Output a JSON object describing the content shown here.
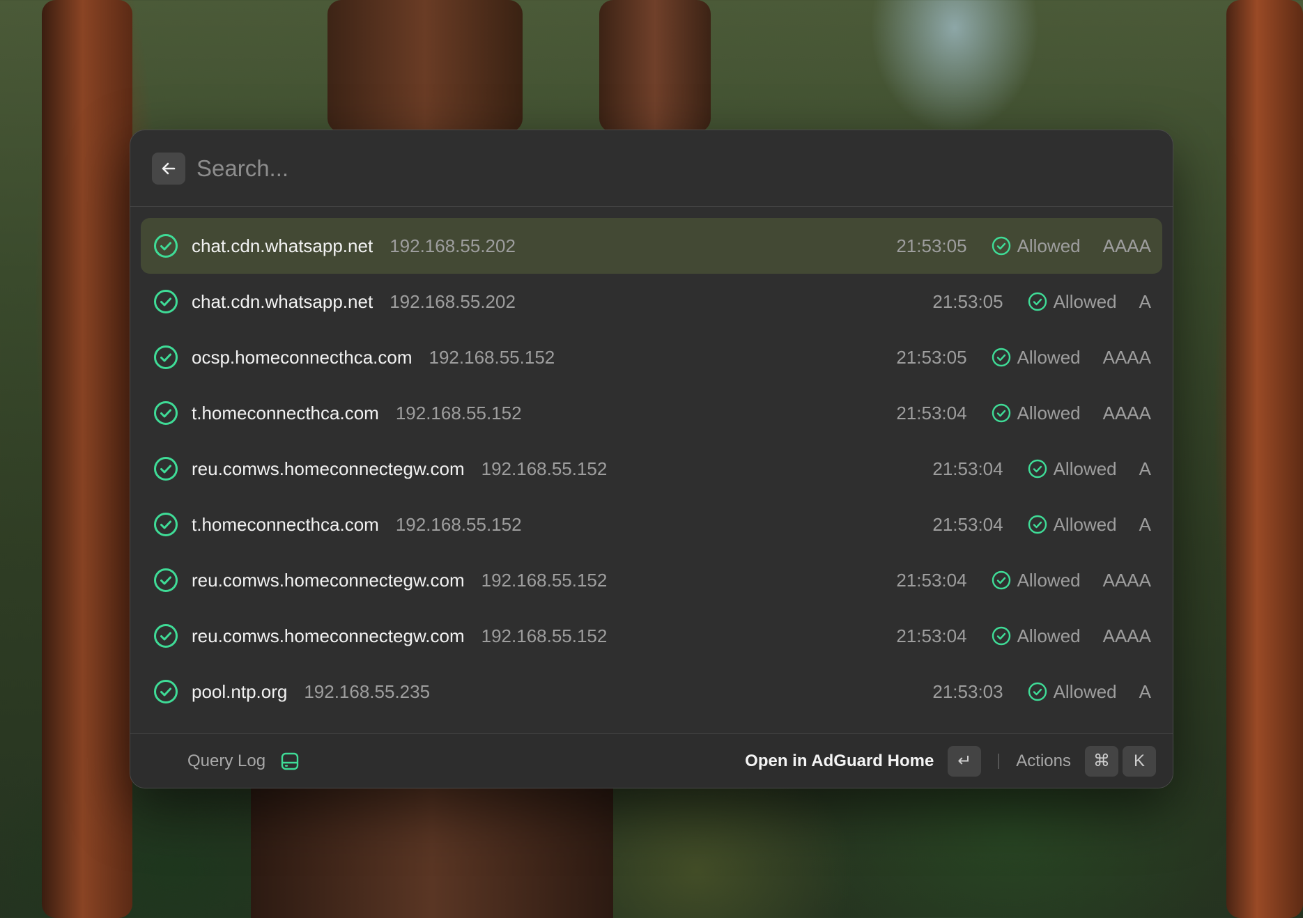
{
  "search": {
    "placeholder": "Search..."
  },
  "rows": [
    {
      "domain": "chat.cdn.whatsapp.net",
      "ip": "192.168.55.202",
      "time": "21:53:05",
      "status": "Allowed",
      "type": "AAAA",
      "selected": true
    },
    {
      "domain": "chat.cdn.whatsapp.net",
      "ip": "192.168.55.202",
      "time": "21:53:05",
      "status": "Allowed",
      "type": "A"
    },
    {
      "domain": "ocsp.homeconnecthca.com",
      "ip": "192.168.55.152",
      "time": "21:53:05",
      "status": "Allowed",
      "type": "AAAA"
    },
    {
      "domain": "t.homeconnecthca.com",
      "ip": "192.168.55.152",
      "time": "21:53:04",
      "status": "Allowed",
      "type": "AAAA"
    },
    {
      "domain": "reu.comws.homeconnectegw.com",
      "ip": "192.168.55.152",
      "time": "21:53:04",
      "status": "Allowed",
      "type": "A"
    },
    {
      "domain": "t.homeconnecthca.com",
      "ip": "192.168.55.152",
      "time": "21:53:04",
      "status": "Allowed",
      "type": "A"
    },
    {
      "domain": "reu.comws.homeconnectegw.com",
      "ip": "192.168.55.152",
      "time": "21:53:04",
      "status": "Allowed",
      "type": "AAAA"
    },
    {
      "domain": "reu.comws.homeconnectegw.com",
      "ip": "192.168.55.152",
      "time": "21:53:04",
      "status": "Allowed",
      "type": "AAAA"
    },
    {
      "domain": "pool.ntp.org",
      "ip": "192.168.55.235",
      "time": "21:53:03",
      "status": "Allowed",
      "type": "A"
    }
  ],
  "footer": {
    "title": "Query Log",
    "title_icon": "hard-drive-icon",
    "primary_action": "Open in AdGuard Home",
    "primary_key": "↵",
    "actions_label": "Actions",
    "actions_keys": [
      "⌘",
      "K"
    ]
  },
  "colors": {
    "accent": "#3fdc97",
    "selected_row": "#434934",
    "window_bg": "#2f2f2f"
  }
}
